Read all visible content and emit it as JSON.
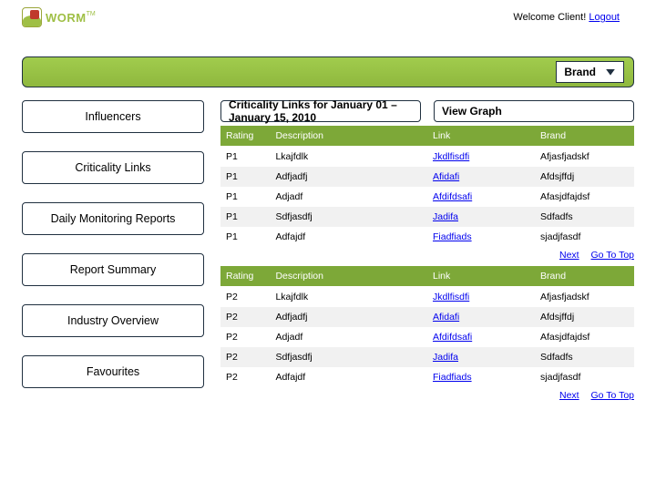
{
  "header": {
    "welcome_prefix": "Welcome Client! ",
    "logout": "Logout",
    "logo_text": "WORM",
    "logo_tm": "TM"
  },
  "brand_bar": {
    "label": "Brand"
  },
  "sidebar": {
    "items": [
      "Influencers",
      "Criticality Links",
      "Daily Monitoring Reports",
      "Report Summary",
      "Industry Overview",
      "Favourites"
    ]
  },
  "content": {
    "title": "Criticality  Links for January 01 – January 15, 2010",
    "view_graph": "View Graph",
    "columns": {
      "rating": "Rating",
      "desc": "Description",
      "link": "Link",
      "brand": "Brand"
    },
    "nav": {
      "next": "Next",
      "top": "Go To Top"
    },
    "tables": [
      {
        "rows": [
          {
            "rating": "P1",
            "desc": "Lkajfdlk",
            "link": "Jkdlfisdfi",
            "brand": "Afjasfjadskf"
          },
          {
            "rating": "P1",
            "desc": "Adfjadfj",
            "link": "Afidafi",
            "brand": "Afdsjffdj"
          },
          {
            "rating": "P1",
            "desc": "Adjadf",
            "link": "Afdifdsafi",
            "brand": "Afasjdfajdsf"
          },
          {
            "rating": "P1",
            "desc": "Sdfjasdfj",
            "link": "Jadifa",
            "brand": "Sdfadfs"
          },
          {
            "rating": "P1",
            "desc": "Adfajdf",
            "link": "Fiadfiads",
            "brand": "sjadjfasdf"
          }
        ]
      },
      {
        "rows": [
          {
            "rating": "P2",
            "desc": "Lkajfdlk",
            "link": "Jkdlfisdfi",
            "brand": "Afjasfjadskf"
          },
          {
            "rating": "P2",
            "desc": "Adfjadfj",
            "link": "Afidafi",
            "brand": "Afdsjffdj"
          },
          {
            "rating": "P2",
            "desc": "Adjadf",
            "link": "Afdifdsafi",
            "brand": "Afasjdfajdsf"
          },
          {
            "rating": "P2",
            "desc": "Sdfjasdfj",
            "link": "Jadifa",
            "brand": "Sdfadfs"
          },
          {
            "rating": "P2",
            "desc": "Adfajdf",
            "link": "Fiadfiads",
            "brand": "sjadjfasdf"
          }
        ]
      }
    ]
  }
}
